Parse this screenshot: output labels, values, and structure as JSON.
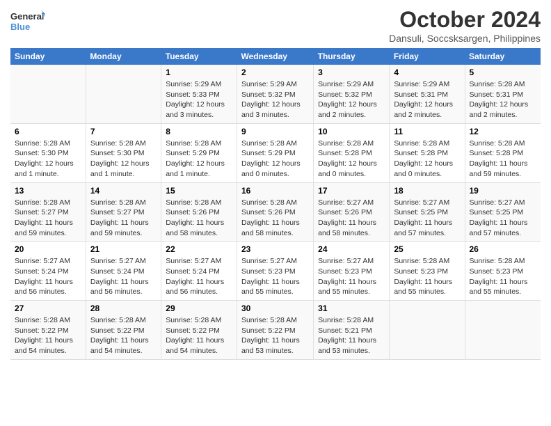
{
  "header": {
    "logo_general": "General",
    "logo_blue": "Blue",
    "title": "October 2024",
    "subtitle": "Dansuli, Soccsksargen, Philippines"
  },
  "days_of_week": [
    "Sunday",
    "Monday",
    "Tuesday",
    "Wednesday",
    "Thursday",
    "Friday",
    "Saturday"
  ],
  "weeks": [
    [
      {
        "day": "",
        "content": ""
      },
      {
        "day": "",
        "content": ""
      },
      {
        "day": "1",
        "content": "Sunrise: 5:29 AM\nSunset: 5:33 PM\nDaylight: 12 hours and 3 minutes."
      },
      {
        "day": "2",
        "content": "Sunrise: 5:29 AM\nSunset: 5:32 PM\nDaylight: 12 hours and 3 minutes."
      },
      {
        "day": "3",
        "content": "Sunrise: 5:29 AM\nSunset: 5:32 PM\nDaylight: 12 hours and 2 minutes."
      },
      {
        "day": "4",
        "content": "Sunrise: 5:29 AM\nSunset: 5:31 PM\nDaylight: 12 hours and 2 minutes."
      },
      {
        "day": "5",
        "content": "Sunrise: 5:28 AM\nSunset: 5:31 PM\nDaylight: 12 hours and 2 minutes."
      }
    ],
    [
      {
        "day": "6",
        "content": "Sunrise: 5:28 AM\nSunset: 5:30 PM\nDaylight: 12 hours and 1 minute."
      },
      {
        "day": "7",
        "content": "Sunrise: 5:28 AM\nSunset: 5:30 PM\nDaylight: 12 hours and 1 minute."
      },
      {
        "day": "8",
        "content": "Sunrise: 5:28 AM\nSunset: 5:29 PM\nDaylight: 12 hours and 1 minute."
      },
      {
        "day": "9",
        "content": "Sunrise: 5:28 AM\nSunset: 5:29 PM\nDaylight: 12 hours and 0 minutes."
      },
      {
        "day": "10",
        "content": "Sunrise: 5:28 AM\nSunset: 5:28 PM\nDaylight: 12 hours and 0 minutes."
      },
      {
        "day": "11",
        "content": "Sunrise: 5:28 AM\nSunset: 5:28 PM\nDaylight: 12 hours and 0 minutes."
      },
      {
        "day": "12",
        "content": "Sunrise: 5:28 AM\nSunset: 5:28 PM\nDaylight: 11 hours and 59 minutes."
      }
    ],
    [
      {
        "day": "13",
        "content": "Sunrise: 5:28 AM\nSunset: 5:27 PM\nDaylight: 11 hours and 59 minutes."
      },
      {
        "day": "14",
        "content": "Sunrise: 5:28 AM\nSunset: 5:27 PM\nDaylight: 11 hours and 59 minutes."
      },
      {
        "day": "15",
        "content": "Sunrise: 5:28 AM\nSunset: 5:26 PM\nDaylight: 11 hours and 58 minutes."
      },
      {
        "day": "16",
        "content": "Sunrise: 5:28 AM\nSunset: 5:26 PM\nDaylight: 11 hours and 58 minutes."
      },
      {
        "day": "17",
        "content": "Sunrise: 5:27 AM\nSunset: 5:26 PM\nDaylight: 11 hours and 58 minutes."
      },
      {
        "day": "18",
        "content": "Sunrise: 5:27 AM\nSunset: 5:25 PM\nDaylight: 11 hours and 57 minutes."
      },
      {
        "day": "19",
        "content": "Sunrise: 5:27 AM\nSunset: 5:25 PM\nDaylight: 11 hours and 57 minutes."
      }
    ],
    [
      {
        "day": "20",
        "content": "Sunrise: 5:27 AM\nSunset: 5:24 PM\nDaylight: 11 hours and 56 minutes."
      },
      {
        "day": "21",
        "content": "Sunrise: 5:27 AM\nSunset: 5:24 PM\nDaylight: 11 hours and 56 minutes."
      },
      {
        "day": "22",
        "content": "Sunrise: 5:27 AM\nSunset: 5:24 PM\nDaylight: 11 hours and 56 minutes."
      },
      {
        "day": "23",
        "content": "Sunrise: 5:27 AM\nSunset: 5:23 PM\nDaylight: 11 hours and 55 minutes."
      },
      {
        "day": "24",
        "content": "Sunrise: 5:27 AM\nSunset: 5:23 PM\nDaylight: 11 hours and 55 minutes."
      },
      {
        "day": "25",
        "content": "Sunrise: 5:28 AM\nSunset: 5:23 PM\nDaylight: 11 hours and 55 minutes."
      },
      {
        "day": "26",
        "content": "Sunrise: 5:28 AM\nSunset: 5:23 PM\nDaylight: 11 hours and 55 minutes."
      }
    ],
    [
      {
        "day": "27",
        "content": "Sunrise: 5:28 AM\nSunset: 5:22 PM\nDaylight: 11 hours and 54 minutes."
      },
      {
        "day": "28",
        "content": "Sunrise: 5:28 AM\nSunset: 5:22 PM\nDaylight: 11 hours and 54 minutes."
      },
      {
        "day": "29",
        "content": "Sunrise: 5:28 AM\nSunset: 5:22 PM\nDaylight: 11 hours and 54 minutes."
      },
      {
        "day": "30",
        "content": "Sunrise: 5:28 AM\nSunset: 5:22 PM\nDaylight: 11 hours and 53 minutes."
      },
      {
        "day": "31",
        "content": "Sunrise: 5:28 AM\nSunset: 5:21 PM\nDaylight: 11 hours and 53 minutes."
      },
      {
        "day": "",
        "content": ""
      },
      {
        "day": "",
        "content": ""
      }
    ]
  ]
}
